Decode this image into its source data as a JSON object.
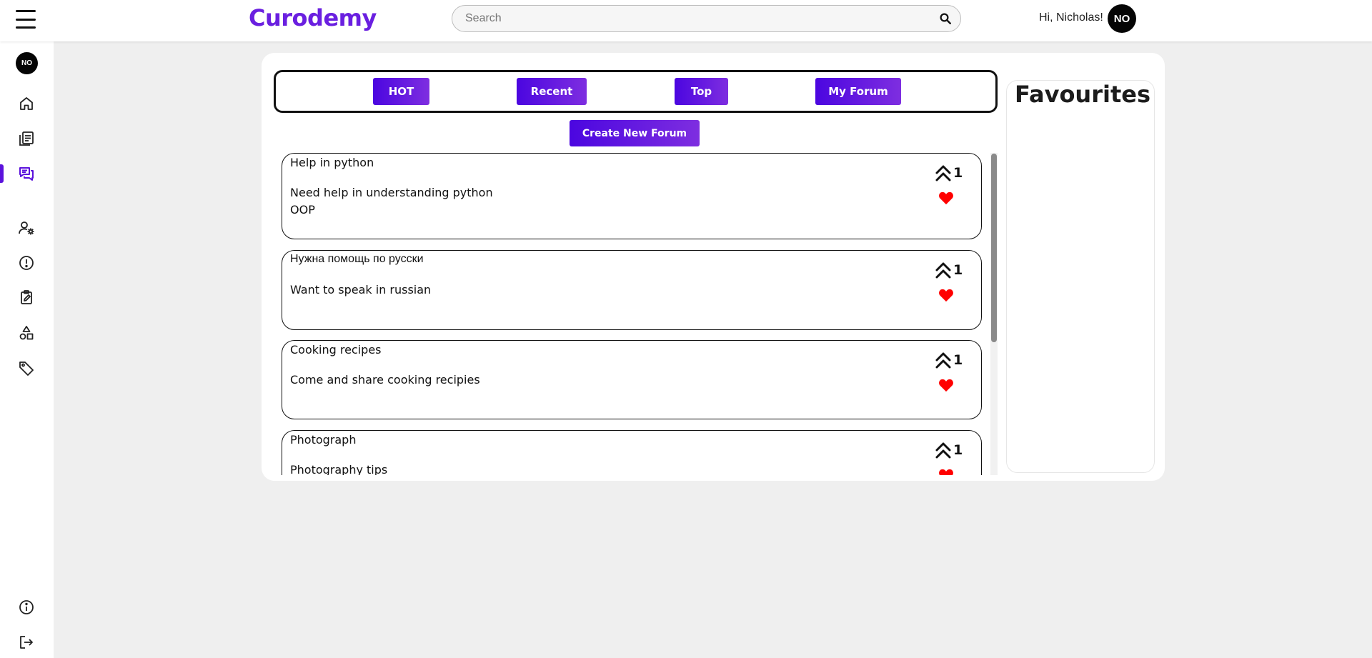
{
  "app": {
    "logo": "Curodemy"
  },
  "header": {
    "search": {
      "placeholder": "Search",
      "value": ""
    },
    "greeting": "Hi, Nicholas!",
    "avatar_initials": "NO"
  },
  "sidebar": {
    "avatar_initials": "NO",
    "items": [
      {
        "icon": "home-icon",
        "active": false
      },
      {
        "icon": "courses-icon",
        "active": false
      },
      {
        "icon": "forum-icon",
        "active": true
      },
      {
        "icon": "user-settings-icon",
        "active": false
      },
      {
        "icon": "alert-icon",
        "active": false
      },
      {
        "icon": "assignment-icon",
        "active": false
      },
      {
        "icon": "shapes-icon",
        "active": false
      },
      {
        "icon": "tag-icon",
        "active": false
      }
    ],
    "bottom_items": [
      {
        "icon": "info-icon"
      },
      {
        "icon": "logout-icon"
      }
    ],
    "accent_color": "#5b12dc"
  },
  "filters": {
    "hot": "HOT",
    "recent": "Recent",
    "top": "Top",
    "my_forum": "My Forum"
  },
  "create_button": "Create New Forum",
  "forums": [
    {
      "title": "Help in python",
      "description": "Need help in understanding python OOP",
      "votes": "1"
    },
    {
      "title": "Нужна помощь по русски",
      "description": "Want to speak in russian",
      "votes": "1"
    },
    {
      "title": "Cooking recipes",
      "description": "Come and share cooking recipies",
      "votes": "1"
    },
    {
      "title": "Photograph",
      "description": "Photography tips",
      "votes": "1"
    }
  ],
  "favourites": {
    "title": "Favourites"
  },
  "colors": {
    "brand": "#6a1fe0",
    "button_gradient_start": "#4b06e0",
    "button_gradient_end": "#7e2ee0",
    "heart": "#ff0000"
  }
}
